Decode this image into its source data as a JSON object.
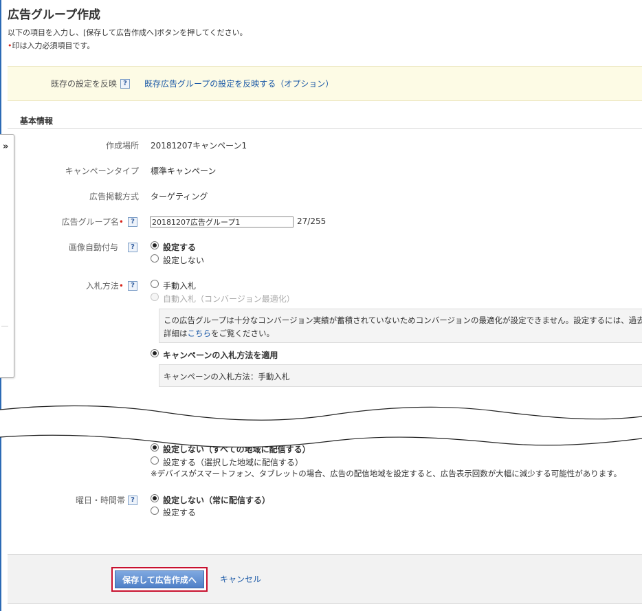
{
  "page": {
    "title": "広告グループ作成",
    "description": "以下の項目を入力し、[保存して広告作成へ]ボタンを押してください。",
    "required_marker": "•",
    "required_note": "印は入力必須項目です。"
  },
  "preset": {
    "label": "既存の設定を反映",
    "help": "?",
    "link": "既存広告グループの設定を反映する（オプション）"
  },
  "basic_info": {
    "section_title": "基本情報",
    "side_tab_icon": "»",
    "fields": {
      "location": {
        "label": "作成場所",
        "value": "20181207キャンペーン1"
      },
      "campaign_type": {
        "label": "キャンペーンタイプ",
        "value": "標準キャンペーン"
      },
      "delivery_method": {
        "label": "広告掲載方式",
        "value": "ターゲティング"
      },
      "ad_group_name": {
        "label": "広告グループ名",
        "required": "•",
        "help": "?",
        "value": "20181207広告グループ1",
        "counter": "27/255"
      },
      "auto_image": {
        "label": "画像自動付与",
        "help": "?",
        "options": [
          "設定する",
          "設定しない"
        ],
        "selected": "設定する"
      },
      "bidding": {
        "label": "入札方法",
        "required": "•",
        "help": "?",
        "options": [
          "手動入札",
          "自動入札（コンバージョン最適化）",
          "キャンペーンの入札方法を適用"
        ],
        "selected": "キャンペーンの入札方法を適用",
        "notice_line1": "この広告グループは十分なコンバージョン実績が蓄積されていないためコンバージョンの最適化が設定できません。設定するには、過去",
        "notice_line2_prefix": "詳細は",
        "notice_link": "こちら",
        "notice_line2_suffix": "をご覧ください。",
        "campaign_bid_info": "キャンペーンの入札方法：手動入札"
      }
    }
  },
  "targeting": {
    "region_options": [
      "設定しない（すべての地域に配信する）",
      "設定する（選択した地域に配信する）"
    ],
    "region_selected": "設定しない（すべての地域に配信する）",
    "device_note": "※デバイスがスマートフォン、タブレットの場合、広告の配信地域を設定すると、広告表示回数が大幅に減少する可能性があります。",
    "schedule": {
      "label": "曜日・時間帯",
      "help": "?",
      "options": [
        "設定しない（常に配信する）",
        "設定する"
      ],
      "selected": "設定しない（常に配信する）"
    }
  },
  "footer": {
    "save_label": "保存して広告作成へ",
    "cancel_label": "キャンセル"
  },
  "colors": {
    "link": "#1a58a6",
    "required": "#d9261c",
    "preset_bg": "#fdfbe5",
    "save_button": "#4f80c8",
    "highlight_border": "#c8102e"
  }
}
